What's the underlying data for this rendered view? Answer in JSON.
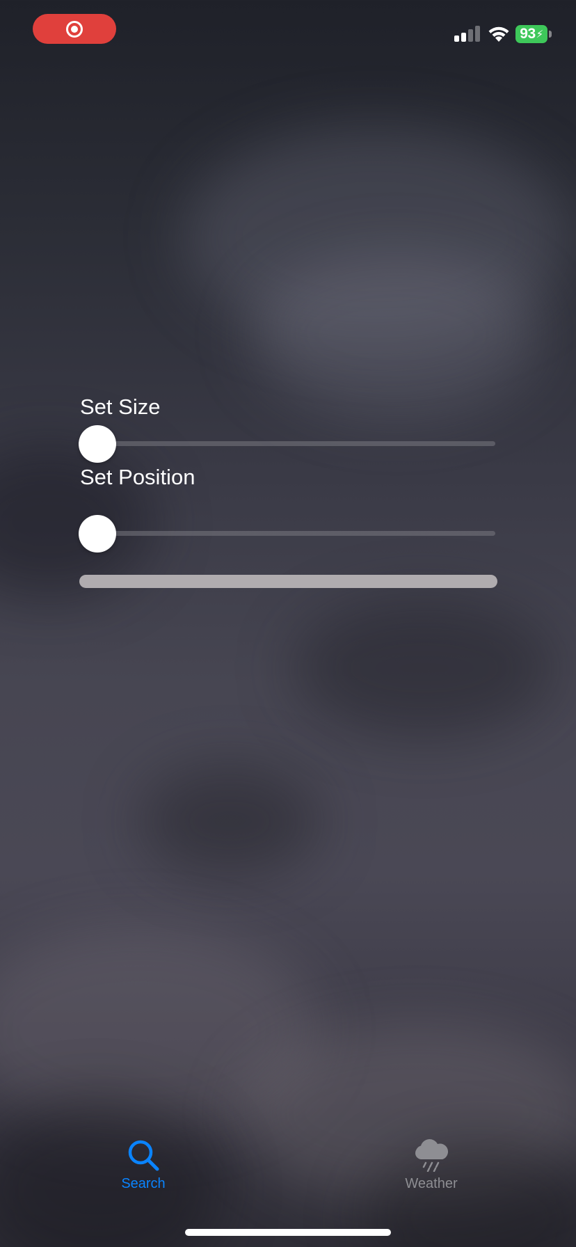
{
  "status_bar": {
    "recording_icon": "screen-recording-icon",
    "signal_icon": "cellular-signal-icon",
    "wifi_icon": "wifi-icon",
    "battery_level": "93",
    "battery_charging": true,
    "battery_color": "#3ec85a",
    "recording_color": "#e0403c"
  },
  "controls": {
    "size_label": "Set Size",
    "size_value": 0,
    "position_label": "Set Position",
    "position_value": 0
  },
  "tab_bar": {
    "items": [
      {
        "label": "Search",
        "icon": "magnifying-glass-icon",
        "selected": true,
        "color": "#0a84ff"
      },
      {
        "label": "Weather",
        "icon": "cloud-rain-icon",
        "selected": false,
        "color": "#8e8e93"
      }
    ]
  }
}
